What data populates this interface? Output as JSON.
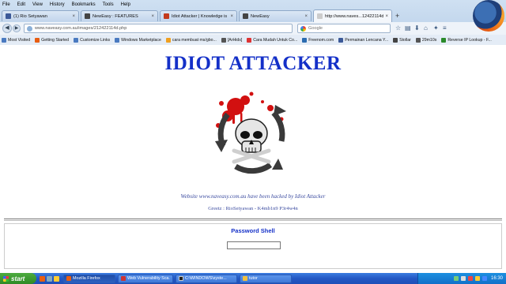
{
  "menu": [
    "File",
    "Edit",
    "View",
    "History",
    "Bookmarks",
    "Tools",
    "Help"
  ],
  "tabs": [
    {
      "label": "(1) Rio Setyawan",
      "color": "#3b5998"
    },
    {
      "label": "NewEasy : FEATURES",
      "color": "#444444"
    },
    {
      "label": "Idiot Attacker | Knowledge is ...",
      "color": "#c33a1c"
    },
    {
      "label": "NewEasy",
      "color": "#444444"
    },
    {
      "label": "http://www.naves...12422114d.php",
      "color": "#888888"
    }
  ],
  "address_bar": {
    "url": "www.naveasy.com.au/images/212422114d.php"
  },
  "search_bar": {
    "placeholder": "Google"
  },
  "bookmarks": [
    {
      "label": "Most Visited",
      "color": "#4a7ac0"
    },
    {
      "label": "Getting Started",
      "color": "#e85d12"
    },
    {
      "label": "Customize Links",
      "color": "#4a7ac0"
    },
    {
      "label": "Windows Marketplace",
      "color": "#4a7ac0"
    },
    {
      "label": "cara membuat ms/gbo...",
      "color": "#f0a020"
    },
    {
      "label": "[ArHids]",
      "color": "#555555"
    },
    {
      "label": "Cara Mudah Untuk Co...",
      "color": "#d33"
    },
    {
      "label": "Freenom.com",
      "color": "#2b6cb0"
    },
    {
      "label": "Permainan Lencana Y...",
      "color": "#3b5998"
    },
    {
      "label": "Stollar",
      "color": "#444444"
    },
    {
      "label": "29m10s",
      "color": "#555555"
    },
    {
      "label": "Reverse IP Lookup - F...",
      "color": "#2a8a2a"
    }
  ],
  "page": {
    "title": "IDIOT ATTACKER",
    "message": "Website www.naveasy.com.au have been hacked by Idiot Attacker",
    "greetz": "Greetz : RioSetyawan - K4mb1n9 P3r4w4n",
    "shell_title": "Password Shell"
  },
  "taskbar": {
    "start": "start",
    "tasks": [
      {
        "label": "Mozilla Firefox",
        "color": "#e85d12"
      },
      {
        "label": "Web Vulnerability Sca...",
        "color": "#c33"
      },
      {
        "label": "C:\\WINDOWS\\syste...",
        "color": "#222"
      },
      {
        "label": "tutor",
        "color": "#f0c040"
      }
    ],
    "time": "16:30"
  }
}
